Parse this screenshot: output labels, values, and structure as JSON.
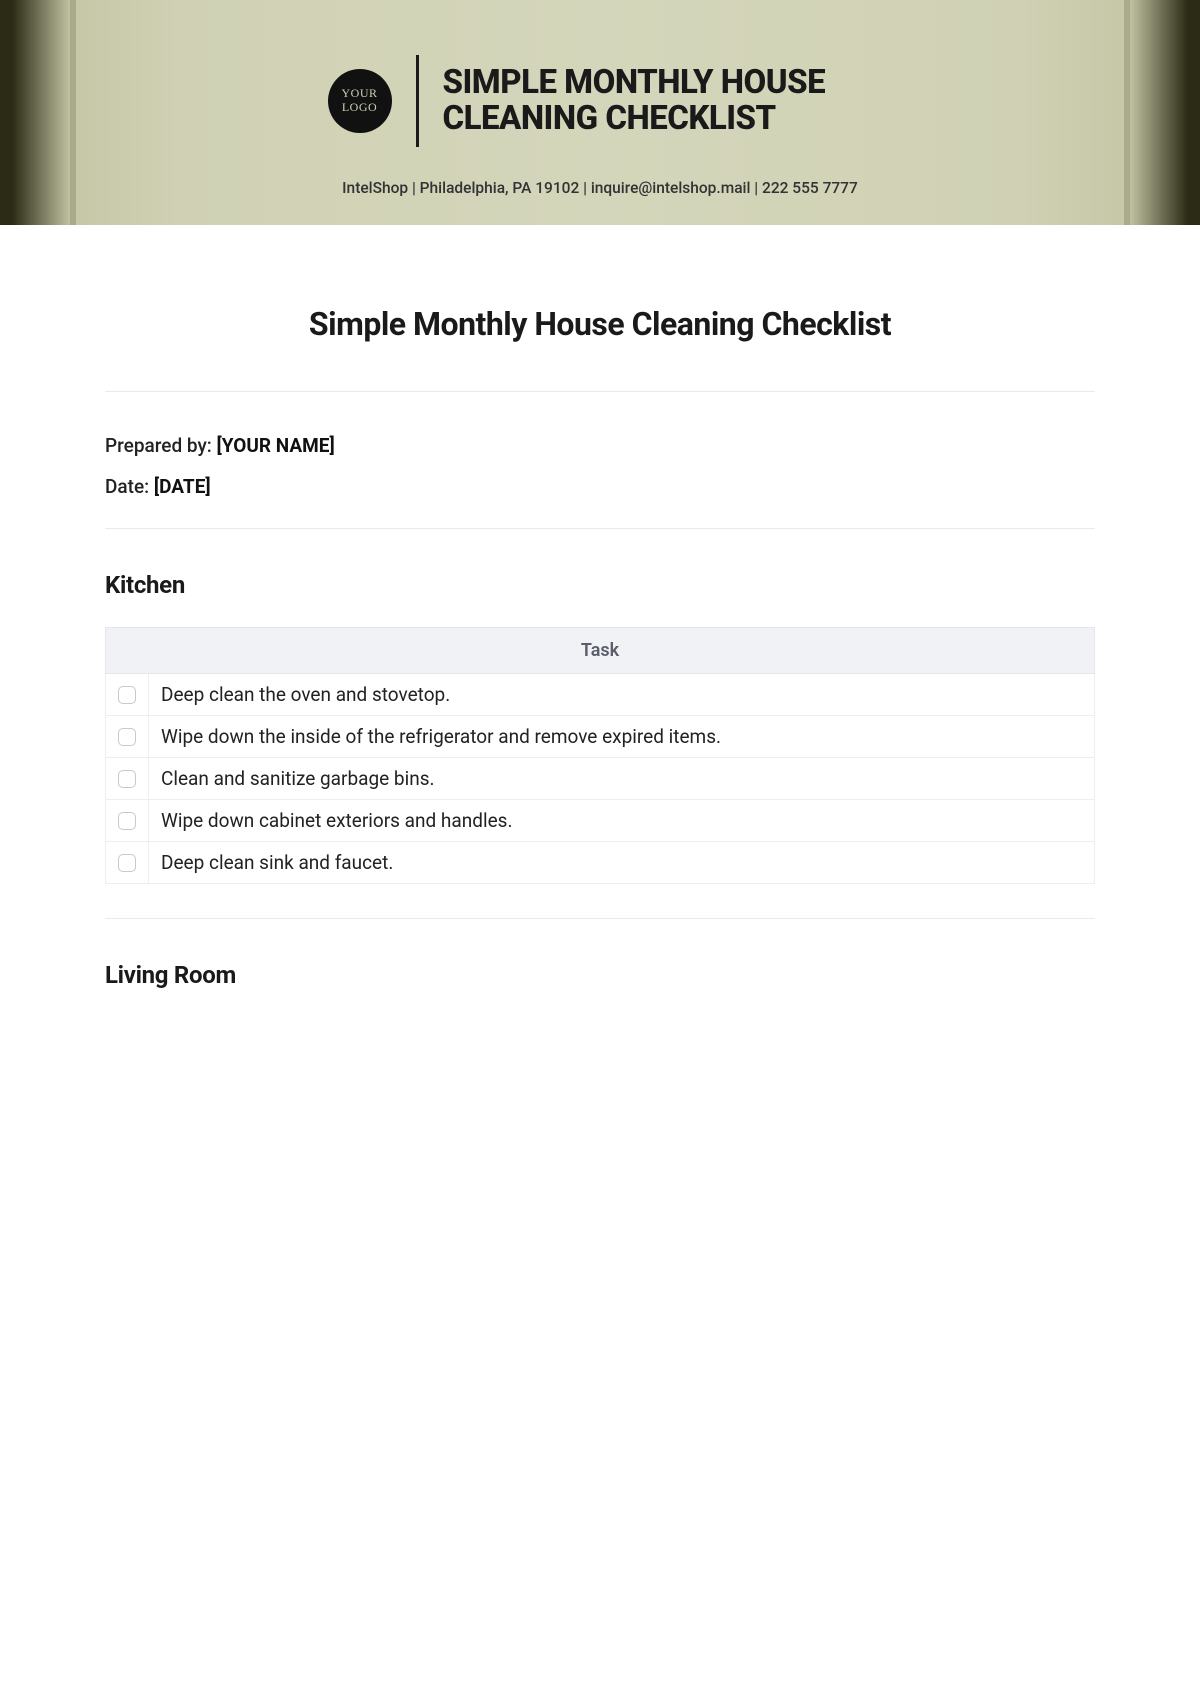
{
  "banner": {
    "logo": {
      "line1": "YOUR",
      "line2": "LOGO"
    },
    "title": "SIMPLE MONTHLY HOUSE CLEANING CHECKLIST",
    "contact": "IntelShop | Philadelphia, PA 19102 | inquire@intelshop.mail | 222 555 7777"
  },
  "page": {
    "title": "Simple Monthly House Cleaning Checklist",
    "prepared_label": "Prepared by: ",
    "prepared_value": "[YOUR NAME]",
    "date_label": "Date: ",
    "date_value": "[DATE]"
  },
  "table_header": "Task",
  "sections": [
    {
      "heading": "Kitchen",
      "tasks": [
        "Deep clean the oven and stovetop.",
        "Wipe down the inside of the refrigerator and remove expired items.",
        "Clean and sanitize garbage bins.",
        "Wipe down cabinet exteriors and handles.",
        "Deep clean sink and faucet."
      ]
    },
    {
      "heading": "Living Room",
      "tasks": []
    }
  ]
}
